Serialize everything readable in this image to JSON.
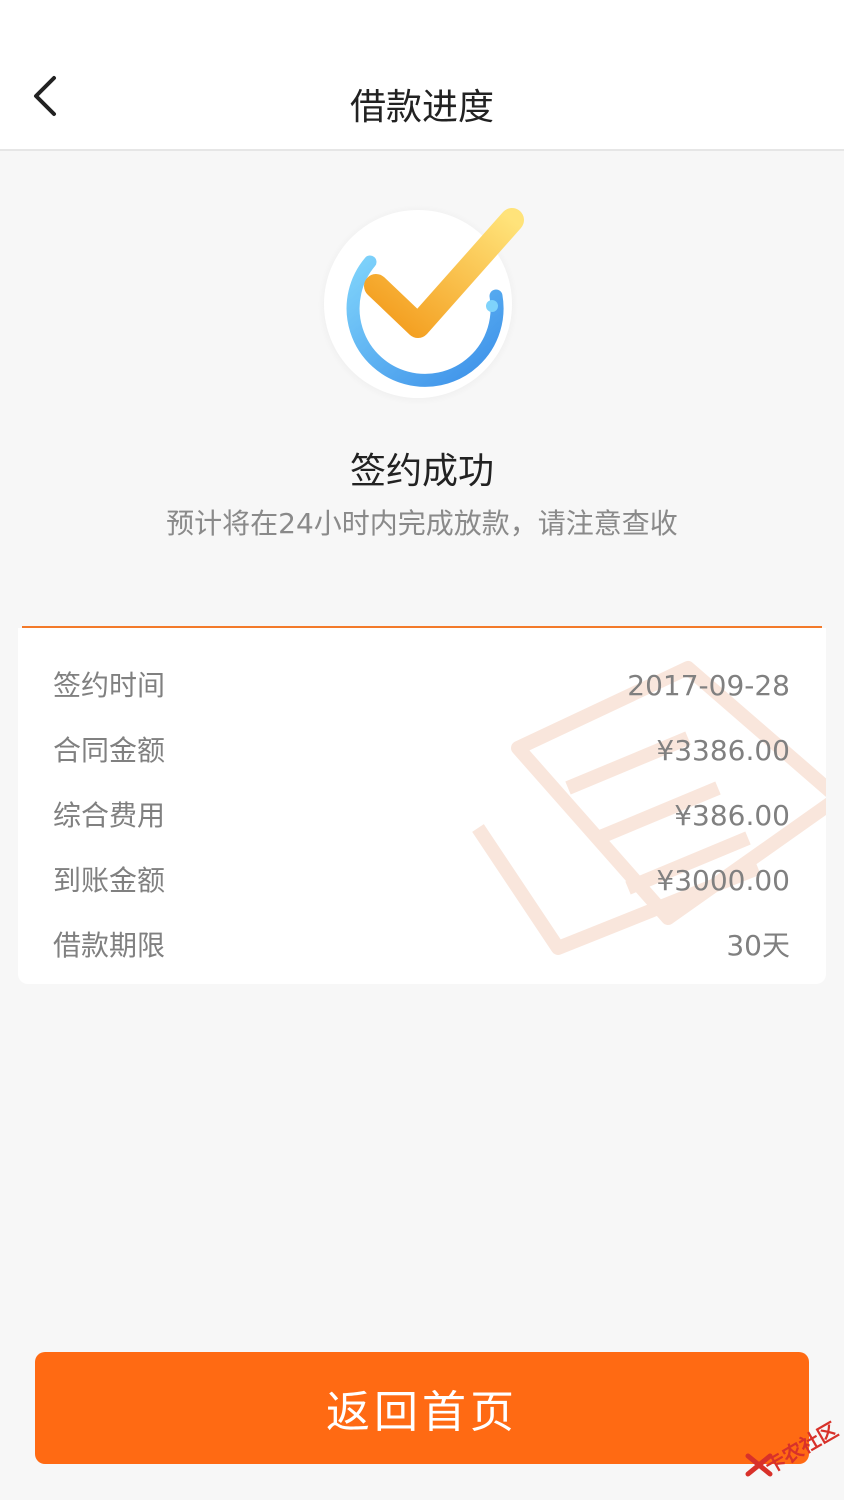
{
  "header": {
    "title": "借款进度",
    "back_icon": "chevron-left-icon"
  },
  "status": {
    "icon": "check-circle-icon",
    "title": "签约成功",
    "subtitle": "预计将在24小时内完成放款，请注意查收"
  },
  "details": {
    "rows": [
      {
        "label": "签约时间",
        "value": "2017-09-28"
      },
      {
        "label": "合同金额",
        "value": "¥3386.00"
      },
      {
        "label": "综合费用",
        "value": "¥386.00"
      },
      {
        "label": "到账金额",
        "value": "¥3000.00"
      },
      {
        "label": "借款期限",
        "value": "30天"
      }
    ]
  },
  "actions": {
    "home_label": "返回首页"
  },
  "watermark": {
    "text": "卡农社区"
  },
  "colors": {
    "accent": "#ff6a13",
    "divider": "#f37a2a",
    "ring_blue": "#4aa3f5",
    "check_orange": "#f7a21b"
  }
}
